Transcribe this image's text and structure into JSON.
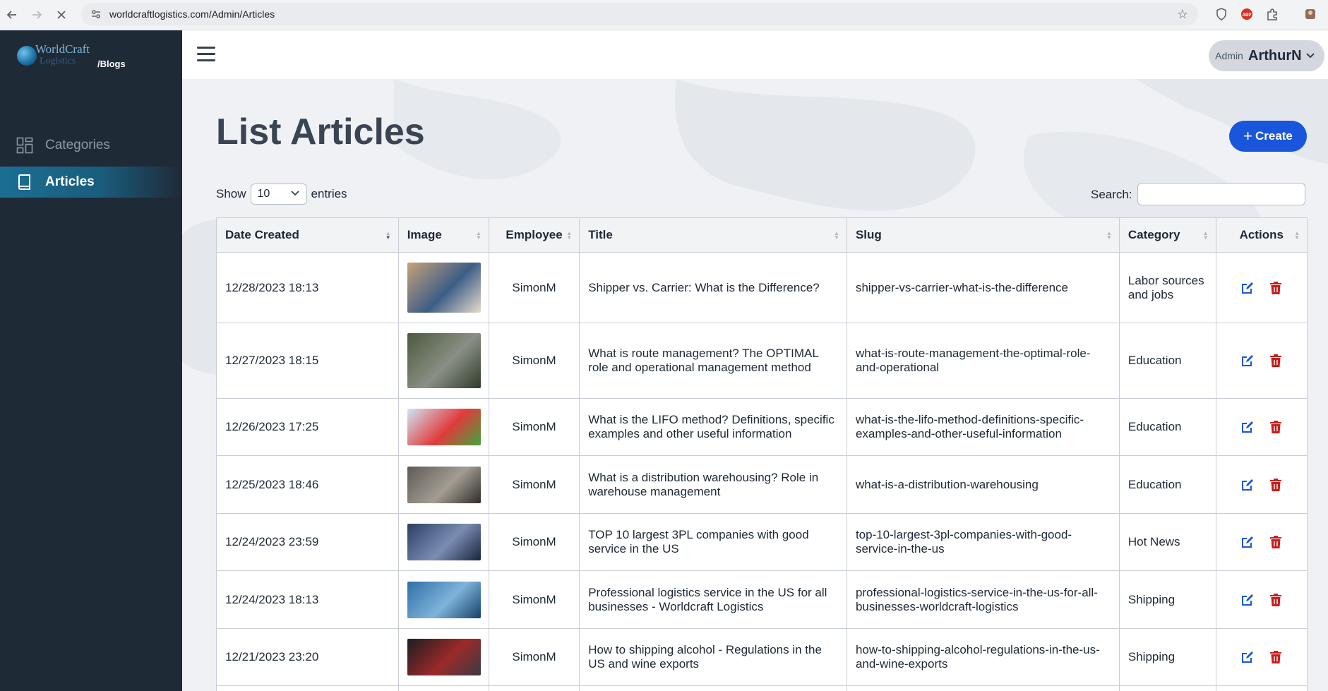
{
  "browser": {
    "url": "worldcraftlogistics.com/Admin/Articles"
  },
  "sidebar": {
    "logo_text": "WorldCraft",
    "logo_text2": "Logistics",
    "logo_suffix": "/Blogs",
    "items": [
      {
        "label": "Categories",
        "icon": "grid-icon",
        "active": false
      },
      {
        "label": "Articles",
        "icon": "book-icon",
        "active": true
      }
    ]
  },
  "header": {
    "avatar_alt": "Admin",
    "username": "ArthurN"
  },
  "main": {
    "title": "List Articles",
    "create_label": "Create",
    "show_label": "Show",
    "entries_label": "entries",
    "page_size": "10",
    "search_label": "Search:",
    "search_value": ""
  },
  "table": {
    "columns": [
      "Date Created",
      "Image",
      "Employee",
      "Title",
      "Slug",
      "Category",
      "Actions"
    ],
    "rows": [
      {
        "date": "12/28/2023 18:13",
        "employee": "SimonM",
        "title": "Shipper vs. Carrier: What is the Difference?",
        "slug": "shipper-vs-carrier-what-is-the-difference",
        "category": "Labor sources and jobs",
        "thumb_colors": [
          "#c7a27a",
          "#3c5d86",
          "#e7dccb"
        ]
      },
      {
        "date": "12/27/2023 18:15",
        "employee": "SimonM",
        "title": "What is route management? The OPTIMAL role and operational management method",
        "slug": "what-is-route-management-the-optimal-role-and-operational",
        "category": "Education",
        "thumb_colors": [
          "#4b5a3c",
          "#8a8f86",
          "#2f3b2a"
        ]
      },
      {
        "date": "12/26/2023 17:25",
        "employee": "SimonM",
        "title": "What is the LIFO method? Definitions, specific examples and other useful information",
        "slug": "what-is-the-lifo-method-definitions-specific-examples-and-other-useful-information",
        "category": "Education",
        "thumb_colors": [
          "#cfe6f5",
          "#e23b3b",
          "#3fa63f"
        ]
      },
      {
        "date": "12/25/2023 18:46",
        "employee": "SimonM",
        "title": "What is a distribution warehousing? Role in warehouse management",
        "slug": "what-is-a-distribution-warehousing",
        "category": "Education",
        "thumb_colors": [
          "#5d5a56",
          "#a39d92",
          "#2e2c29"
        ]
      },
      {
        "date": "12/24/2023 23:59",
        "employee": "SimonM",
        "title": "TOP 10 largest 3PL companies with good service in the US",
        "slug": "top-10-largest-3pl-companies-with-good-service-in-the-us",
        "category": "Hot News",
        "thumb_colors": [
          "#2c3e63",
          "#7a8db3",
          "#1a243d"
        ]
      },
      {
        "date": "12/24/2023 18:13",
        "employee": "SimonM",
        "title": "Professional logistics service in the US for all businesses - Worldcraft Logistics",
        "slug": "professional-logistics-service-in-the-us-for-all-businesses-worldcraft-logistics",
        "category": "Shipping",
        "thumb_colors": [
          "#2f6fa7",
          "#7fb3da",
          "#16406a"
        ]
      },
      {
        "date": "12/21/2023 23:20",
        "employee": "SimonM",
        "title": "How to shipping alcohol - Regulations in the US and wine exports",
        "slug": "how-to-shipping-alcohol-regulations-in-the-us-and-wine-exports",
        "category": "Shipping",
        "thumb_colors": [
          "#1d1d22",
          "#9b2a2a",
          "#3a3a44"
        ]
      }
    ]
  },
  "colors": {
    "sidebar_bg": "#1f2a37",
    "accent": "#1a56db",
    "edit_icon": "#1a56db",
    "delete_icon": "#c81e1e"
  }
}
